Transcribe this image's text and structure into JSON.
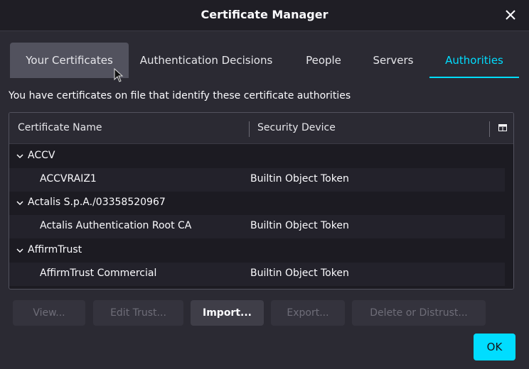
{
  "window": {
    "title": "Certificate Manager"
  },
  "tabs": [
    {
      "label": "Your Certificates"
    },
    {
      "label": "Authentication Decisions"
    },
    {
      "label": "People"
    },
    {
      "label": "Servers"
    },
    {
      "label": "Authorities"
    }
  ],
  "description": "You have certificates on file that identify these certificate authorities",
  "table": {
    "columns": [
      "Certificate Name",
      "Security Device"
    ],
    "groups": [
      {
        "name": "ACCV",
        "children": [
          {
            "name": "ACCVRAIZ1",
            "device": "Builtin Object Token"
          }
        ]
      },
      {
        "name": "Actalis S.p.A./03358520967",
        "children": [
          {
            "name": "Actalis Authentication Root CA",
            "device": "Builtin Object Token"
          }
        ]
      },
      {
        "name": "AffirmTrust",
        "children": [
          {
            "name": "AffirmTrust Commercial",
            "device": "Builtin Object Token"
          }
        ]
      }
    ]
  },
  "buttons": {
    "view": "View...",
    "edit_trust": "Edit Trust...",
    "import": "Import...",
    "export": "Export...",
    "delete": "Delete or Distrust...",
    "ok": "OK"
  },
  "colors": {
    "accent": "#00ddff",
    "background": "#2b2a33",
    "tree_background": "#1c1b22"
  }
}
